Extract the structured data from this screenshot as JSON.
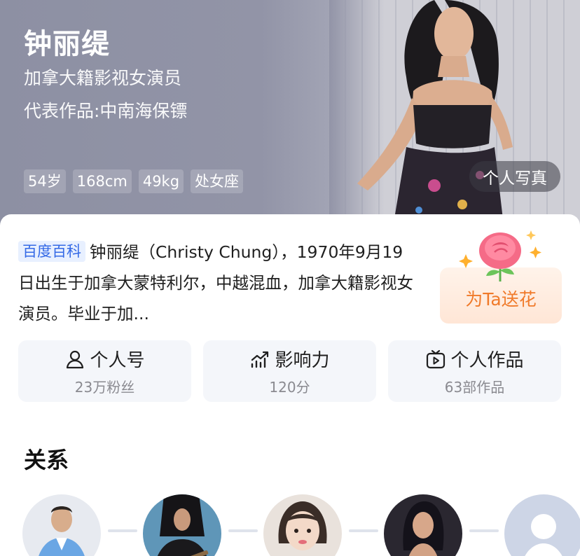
{
  "hero": {
    "name": "钟丽缇",
    "subtitle_1": "加拿大籍影视女演员",
    "subtitle_2": "代表作品:中南海保镖",
    "tags": [
      "54岁",
      "168cm",
      "49kg",
      "处女座"
    ],
    "photo_button": "个人写真"
  },
  "intro": {
    "badge": "百度百科",
    "text": "钟丽缇（Christy Chung），1970年9月19日出生于加拿大蒙特利尔，中越混血，加拿大籍影视女演员。毕业于加..."
  },
  "flower": {
    "label": "为Ta送花"
  },
  "stats": [
    {
      "title": "个人号",
      "sub": "23万粉丝",
      "icon": "person-icon"
    },
    {
      "title": "影响力",
      "sub": "120分",
      "icon": "trend-icon"
    },
    {
      "title": "个人作品",
      "sub": "63部作品",
      "icon": "video-icon"
    }
  ],
  "relations": {
    "title": "关系",
    "avatars": [
      "avatar-man-blue-suit",
      "avatar-guitarist",
      "avatar-girl",
      "avatar-woman",
      "avatar-placeholder"
    ]
  },
  "colors": {
    "hero_bg": "#9294a7",
    "baike_blue": "#3469e6",
    "flower_orange": "#f07a2a",
    "stat_bg": "#f4f6fa"
  }
}
